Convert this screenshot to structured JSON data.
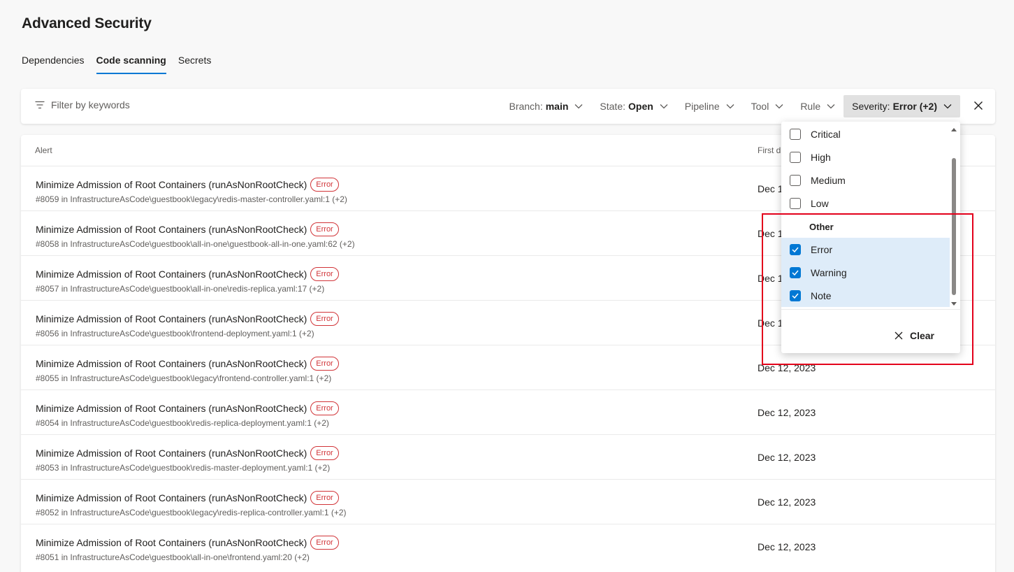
{
  "page": {
    "title": "Advanced Security"
  },
  "tabs": [
    {
      "label": "Dependencies",
      "active": false
    },
    {
      "label": "Code scanning",
      "active": true
    },
    {
      "label": "Secrets",
      "active": false
    }
  ],
  "filter_bar": {
    "placeholder": "Filter by keywords",
    "pills": [
      {
        "label": "Branch:",
        "value": "main"
      },
      {
        "label": "State:",
        "value": "Open"
      },
      {
        "label": "Pipeline",
        "value": ""
      },
      {
        "label": "Tool",
        "value": ""
      },
      {
        "label": "Rule",
        "value": ""
      },
      {
        "label": "Severity:",
        "value": "Error (+2)"
      }
    ]
  },
  "table": {
    "col_alert": "Alert",
    "col_first_detected": "First d",
    "badge_label": "Error",
    "rows": [
      {
        "title": "Minimize Admission of Root Containers (runAsNonRootCheck)",
        "path": "#8059 in InfrastructureAsCode\\guestbook\\legacy\\redis-master-controller.yaml:1 (+2)",
        "date": "Dec 1"
      },
      {
        "title": "Minimize Admission of Root Containers (runAsNonRootCheck)",
        "path": "#8058 in InfrastructureAsCode\\guestbook\\all-in-one\\guestbook-all-in-one.yaml:62 (+2)",
        "date": "Dec 1"
      },
      {
        "title": "Minimize Admission of Root Containers (runAsNonRootCheck)",
        "path": "#8057 in InfrastructureAsCode\\guestbook\\all-in-one\\redis-replica.yaml:17 (+2)",
        "date": "Dec 1"
      },
      {
        "title": "Minimize Admission of Root Containers (runAsNonRootCheck)",
        "path": "#8056 in InfrastructureAsCode\\guestbook\\frontend-deployment.yaml:1 (+2)",
        "date": "Dec 1"
      },
      {
        "title": "Minimize Admission of Root Containers (runAsNonRootCheck)",
        "path": "#8055 in InfrastructureAsCode\\guestbook\\legacy\\frontend-controller.yaml:1 (+2)",
        "date": "Dec 12, 2023"
      },
      {
        "title": "Minimize Admission of Root Containers (runAsNonRootCheck)",
        "path": "#8054 in InfrastructureAsCode\\guestbook\\redis-replica-deployment.yaml:1 (+2)",
        "date": "Dec 12, 2023"
      },
      {
        "title": "Minimize Admission of Root Containers (runAsNonRootCheck)",
        "path": "#8053 in InfrastructureAsCode\\guestbook\\redis-master-deployment.yaml:1 (+2)",
        "date": "Dec 12, 2023"
      },
      {
        "title": "Minimize Admission of Root Containers (runAsNonRootCheck)",
        "path": "#8052 in InfrastructureAsCode\\guestbook\\legacy\\redis-replica-controller.yaml:1 (+2)",
        "date": "Dec 12, 2023"
      },
      {
        "title": "Minimize Admission of Root Containers (runAsNonRootCheck)",
        "path": "#8051 in InfrastructureAsCode\\guestbook\\all-in-one\\frontend.yaml:20 (+2)",
        "date": "Dec 12, 2023"
      }
    ]
  },
  "severity_dropdown": {
    "options": [
      {
        "label": "Critical",
        "checked": false
      },
      {
        "label": "High",
        "checked": false
      },
      {
        "label": "Medium",
        "checked": false
      },
      {
        "label": "Low",
        "checked": false
      }
    ],
    "group_label": "Other",
    "other_options": [
      {
        "label": "Error",
        "checked": true
      },
      {
        "label": "Warning",
        "checked": true
      },
      {
        "label": "Note",
        "checked": true
      }
    ],
    "clear_label": "Clear"
  },
  "colors": {
    "accent": "#0078d4",
    "error": "#d13438",
    "highlight_box": "#e3001b",
    "checked_row_bg": "#deecf9"
  },
  "icons": [
    "filter-icon",
    "chevron-down-icon",
    "close-icon",
    "checkmark-icon",
    "scroll-up-arrow-icon",
    "scroll-down-arrow-icon"
  ]
}
